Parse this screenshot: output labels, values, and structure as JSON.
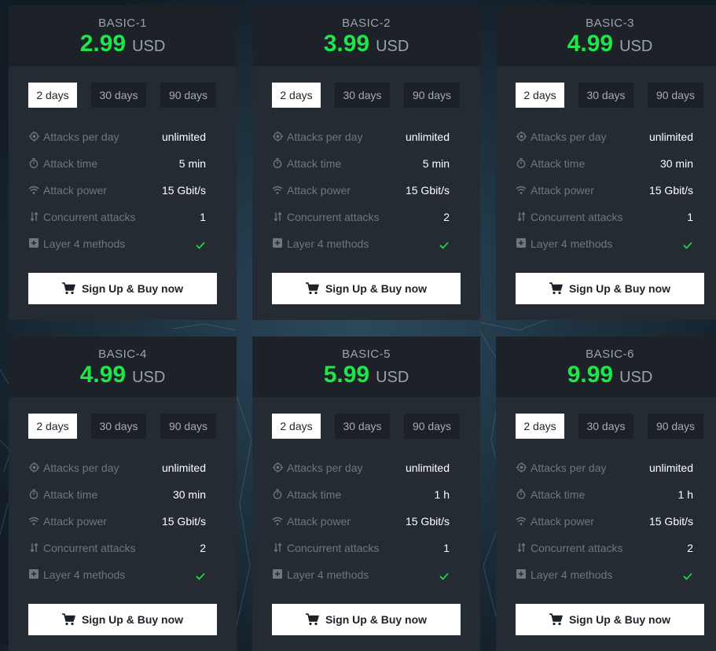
{
  "colors": {
    "price": "#1ee64a",
    "card": "#252b33",
    "card_head": "#1d2228",
    "muted": "#6d7780",
    "check": "#1ee64a"
  },
  "common": {
    "tabs": [
      "2 days",
      "30 days",
      "90 days"
    ],
    "labels": [
      "Attacks per day",
      "Attack time",
      "Attack power",
      "Concurrent attacks",
      "Layer 4 methods"
    ],
    "icons": [
      "target-icon",
      "stopwatch-icon",
      "wifi-icon",
      "arrows-icon",
      "plus-square-icon"
    ],
    "button_label": "Sign Up & Buy now",
    "button_icon": "cart-icon",
    "check_icon": "checkmark-icon"
  },
  "plans": [
    {
      "name": "BASIC-1",
      "price": "2.99",
      "currency": "USD",
      "active_tab": 0,
      "values": [
        "unlimited",
        "5 min",
        "15 Gbit/s",
        "1",
        "✓"
      ]
    },
    {
      "name": "BASIC-2",
      "price": "3.99",
      "currency": "USD",
      "active_tab": 0,
      "values": [
        "unlimited",
        "5 min",
        "15 Gbit/s",
        "2",
        "✓"
      ]
    },
    {
      "name": "BASIC-3",
      "price": "4.99",
      "currency": "USD",
      "active_tab": 0,
      "values": [
        "unlimited",
        "30 min",
        "15 Gbit/s",
        "1",
        "✓"
      ]
    },
    {
      "name": "BASIC-4",
      "price": "4.99",
      "currency": "USD",
      "active_tab": 0,
      "values": [
        "unlimited",
        "30 min",
        "15 Gbit/s",
        "2",
        "✓"
      ]
    },
    {
      "name": "BASIC-5",
      "price": "5.99",
      "currency": "USD",
      "active_tab": 0,
      "values": [
        "unlimited",
        "1 h",
        "15 Gbit/s",
        "1",
        "✓"
      ]
    },
    {
      "name": "BASIC-6",
      "price": "9.99",
      "currency": "USD",
      "active_tab": 0,
      "values": [
        "unlimited",
        "1 h",
        "15 Gbit/s",
        "2",
        "✓"
      ]
    }
  ]
}
